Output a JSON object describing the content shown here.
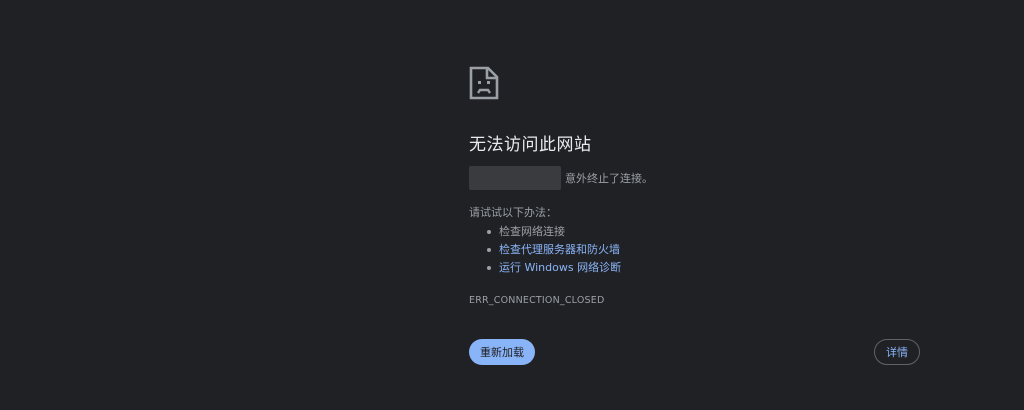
{
  "error": {
    "icon": "sad-page-icon",
    "title": "无法访问此网站",
    "host_message": "意外终止了连接。",
    "suggest_heading": "请试试以下办法：",
    "suggestions": [
      {
        "label": "检查网络连接",
        "link": false
      },
      {
        "label": "检查代理服务器和防火墙",
        "link": true
      },
      {
        "label": "运行 Windows 网络诊断",
        "link": true
      }
    ],
    "code": "ERR_CONNECTION_CLOSED"
  },
  "buttons": {
    "reload_label": "重新加载",
    "details_label": "详情"
  },
  "colors": {
    "background": "#202124",
    "primary_text": "#e8eaed",
    "secondary_text": "#9aa0a6",
    "accent": "#8ab4f8"
  }
}
